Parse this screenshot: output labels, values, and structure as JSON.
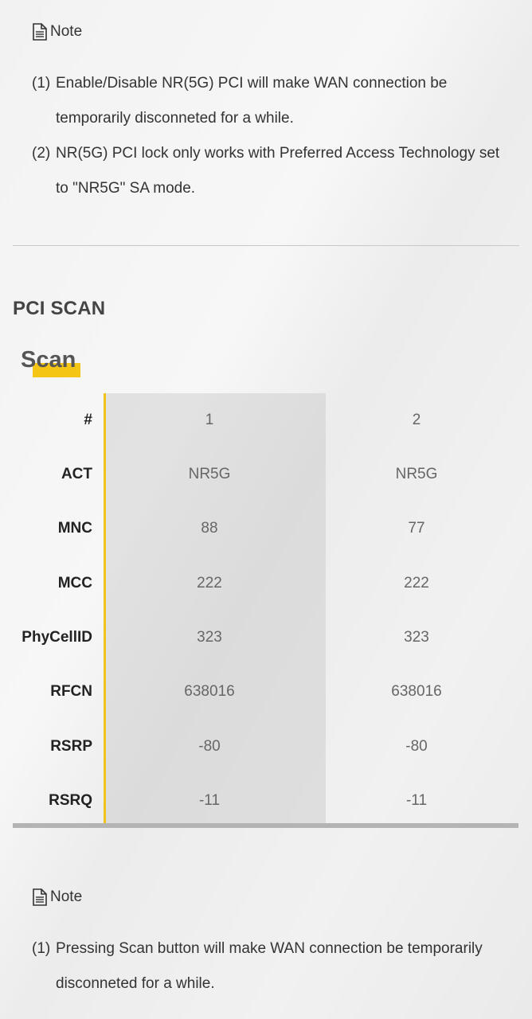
{
  "note_top": {
    "title": "Note",
    "items": [
      {
        "num": "(1)",
        "text": "Enable/Disable NR(5G) PCI will make WAN connection be temporarily disconneted for a while."
      },
      {
        "num": "(2)",
        "text": "NR(5G) PCI lock only works with Preferred Access Technology set to \"NR5G\" SA mode."
      }
    ]
  },
  "section": {
    "title": "PCI SCAN",
    "tab_label": "Scan",
    "accent_color": "#f5c515"
  },
  "table": {
    "rows": [
      {
        "label": "#",
        "v1": "1",
        "v2": "2"
      },
      {
        "label": "ACT",
        "v1": "NR5G",
        "v2": "NR5G"
      },
      {
        "label": "MNC",
        "v1": "88",
        "v2": "77"
      },
      {
        "label": "MCC",
        "v1": "222",
        "v2": "222"
      },
      {
        "label": "PhyCellID",
        "v1": "323",
        "v2": "323"
      },
      {
        "label": "RFCN",
        "v1": "638016",
        "v2": "638016"
      },
      {
        "label": "RSRP",
        "v1": "-80",
        "v2": "-80"
      },
      {
        "label": "RSRQ",
        "v1": "-11",
        "v2": "-11"
      }
    ]
  },
  "note_bottom": {
    "title": "Note",
    "items": [
      {
        "num": "(1)",
        "text": "Pressing Scan button will make WAN connection be temporarily disconneted for a while."
      }
    ]
  }
}
